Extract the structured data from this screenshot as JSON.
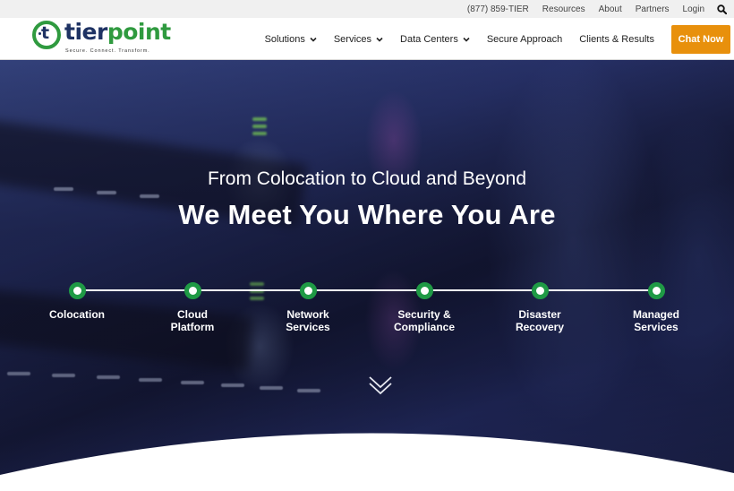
{
  "topbar": {
    "phone": "(877) 859-TIER",
    "links": [
      "Resources",
      "About",
      "Partners",
      "Login"
    ],
    "search_icon": "search-icon"
  },
  "header": {
    "logo": {
      "part1": "tier",
      "part2": "point",
      "mark_letter": "t",
      "tagline": "Secure. Connect. Transform."
    },
    "nav": [
      {
        "label": "Solutions",
        "has_dropdown": true
      },
      {
        "label": "Services",
        "has_dropdown": true
      },
      {
        "label": "Data Centers",
        "has_dropdown": true
      },
      {
        "label": "Secure Approach",
        "has_dropdown": false
      },
      {
        "label": "Clients & Results",
        "has_dropdown": false
      }
    ],
    "cta": "Chat Now"
  },
  "hero": {
    "subtitle": "From Colocation to Cloud and Beyond",
    "title": "We Meet You Where You Are",
    "steps": [
      {
        "line1": "Colocation",
        "line2": ""
      },
      {
        "line1": "Cloud",
        "line2": "Platform"
      },
      {
        "line1": "Network",
        "line2": "Services"
      },
      {
        "line1": "Security &",
        "line2": "Compliance"
      },
      {
        "line1": "Disaster",
        "line2": "Recovery"
      },
      {
        "line1": "Managed",
        "line2": "Services"
      }
    ],
    "scroll_icon": "double-chevron-down-icon"
  },
  "colors": {
    "brand_green": "#2f9a3f",
    "brand_navy": "#1e3263",
    "cta_orange": "#e8900c",
    "node_green": "#1f9a45"
  }
}
